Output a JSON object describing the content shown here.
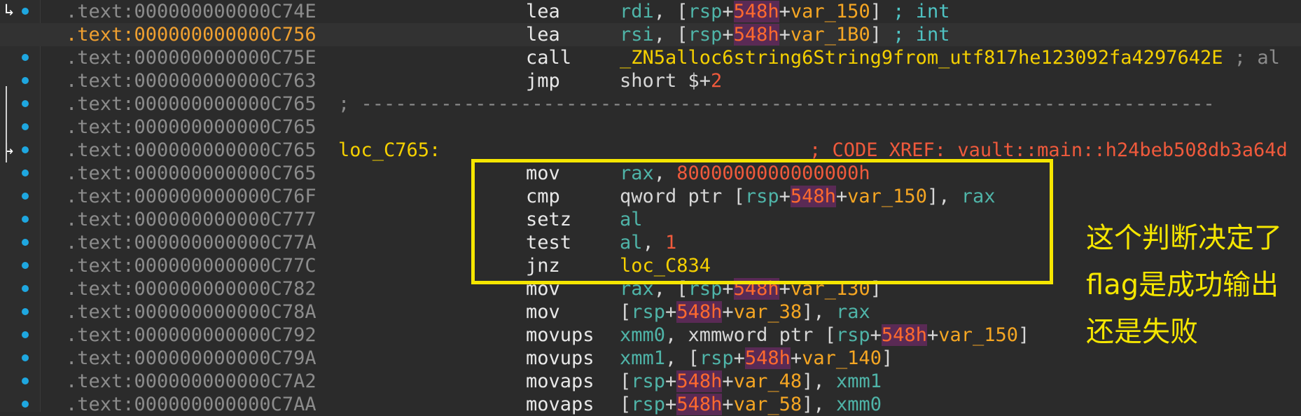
{
  "rows": [
    {
      "addr": ".text:000000000000C74E",
      "mnemonic": "lea",
      "ops": [
        [
          "reg",
          "rdi"
        ],
        [
          "plain",
          ", ["
        ],
        [
          "reg",
          "rsp"
        ],
        [
          "plain",
          "+"
        ],
        [
          "magbg",
          "548h"
        ],
        [
          "plain",
          "+"
        ],
        [
          "var",
          "var_150"
        ],
        [
          "plain",
          "] "
        ],
        [
          "cmt",
          "; int"
        ]
      ]
    },
    {
      "addr": ".text:000000000000C756",
      "current": true,
      "mnemonic": "lea",
      "ops": [
        [
          "reg",
          "rsi"
        ],
        [
          "plain",
          ", ["
        ],
        [
          "reg",
          "rsp"
        ],
        [
          "plain",
          "+"
        ],
        [
          "magbg",
          "548h"
        ],
        [
          "plain",
          "+"
        ],
        [
          "var",
          "var_1B0"
        ],
        [
          "plain",
          "] "
        ],
        [
          "cmt",
          "; int"
        ]
      ]
    },
    {
      "addr": ".text:000000000000C75E",
      "mnemonic": "call",
      "ops": [
        [
          "sym",
          "_ZN5alloc6string6String9from_utf817he123092fa4297642E"
        ],
        [
          "gray",
          " ; al"
        ]
      ]
    },
    {
      "addr": ".text:000000000000C763",
      "mnemonic": "jmp",
      "ops": [
        [
          "plain",
          "short $+"
        ],
        [
          "num",
          "2"
        ]
      ]
    },
    {
      "addr": ".text:000000000000C765",
      "sep": "; ---------------------------------------------------------------------------"
    },
    {
      "addr": ".text:000000000000C765"
    },
    {
      "addr": ".text:000000000000C765",
      "label": "loc_C765:",
      "xref": "; CODE XREF: vault::main::h24beb508db3a64d"
    },
    {
      "addr": ".text:000000000000C765",
      "mnemonic": "mov",
      "ops": [
        [
          "reg",
          "rax"
        ],
        [
          "plain",
          ", "
        ],
        [
          "num",
          "8000000000000000h"
        ]
      ]
    },
    {
      "addr": ".text:000000000000C76F",
      "mnemonic": "cmp",
      "ops": [
        [
          "plain",
          "qword ptr ["
        ],
        [
          "reg",
          "rsp"
        ],
        [
          "plain",
          "+"
        ],
        [
          "magbg",
          "548h"
        ],
        [
          "plain",
          "+"
        ],
        [
          "var",
          "var_150"
        ],
        [
          "plain",
          "], "
        ],
        [
          "reg",
          "rax"
        ]
      ]
    },
    {
      "addr": ".text:000000000000C777",
      "mnemonic": "setz",
      "ops": [
        [
          "reg",
          "al"
        ]
      ]
    },
    {
      "addr": ".text:000000000000C77A",
      "mnemonic": "test",
      "ops": [
        [
          "reg",
          "al"
        ],
        [
          "plain",
          ", "
        ],
        [
          "num",
          "1"
        ]
      ]
    },
    {
      "addr": ".text:000000000000C77C",
      "mnemonic": "jnz",
      "ops": [
        [
          "sym",
          "loc_C834"
        ]
      ]
    },
    {
      "addr": ".text:000000000000C782",
      "mnemonic": "mov",
      "ops": [
        [
          "reg",
          "rax"
        ],
        [
          "plain",
          ", ["
        ],
        [
          "reg",
          "rsp"
        ],
        [
          "plain",
          "+"
        ],
        [
          "magbg",
          "548h"
        ],
        [
          "plain",
          "+"
        ],
        [
          "var",
          "var_130"
        ],
        [
          "plain",
          "]"
        ]
      ]
    },
    {
      "addr": ".text:000000000000C78A",
      "mnemonic": "mov",
      "ops": [
        [
          "plain",
          "["
        ],
        [
          "reg",
          "rsp"
        ],
        [
          "plain",
          "+"
        ],
        [
          "magbg",
          "548h"
        ],
        [
          "plain",
          "+"
        ],
        [
          "var",
          "var_38"
        ],
        [
          "plain",
          "], "
        ],
        [
          "reg",
          "rax"
        ]
      ]
    },
    {
      "addr": ".text:000000000000C792",
      "mnemonic": "movups",
      "ops": [
        [
          "reg",
          "xmm0"
        ],
        [
          "plain",
          ", xmmword ptr ["
        ],
        [
          "reg",
          "rsp"
        ],
        [
          "plain",
          "+"
        ],
        [
          "magbg",
          "548h"
        ],
        [
          "plain",
          "+"
        ],
        [
          "var",
          "var_150"
        ],
        [
          "plain",
          "]"
        ]
      ]
    },
    {
      "addr": ".text:000000000000C79A",
      "mnemonic": "movups",
      "ops": [
        [
          "reg",
          "xmm1"
        ],
        [
          "plain",
          ", ["
        ],
        [
          "reg",
          "rsp"
        ],
        [
          "plain",
          "+"
        ],
        [
          "magbg",
          "548h"
        ],
        [
          "plain",
          "+"
        ],
        [
          "var",
          "var_140"
        ],
        [
          "plain",
          "]"
        ]
      ]
    },
    {
      "addr": ".text:000000000000C7A2",
      "mnemonic": "movaps",
      "ops": [
        [
          "plain",
          "["
        ],
        [
          "reg",
          "rsp"
        ],
        [
          "plain",
          "+"
        ],
        [
          "magbg",
          "548h"
        ],
        [
          "plain",
          "+"
        ],
        [
          "var",
          "var_48"
        ],
        [
          "plain",
          "], "
        ],
        [
          "reg",
          "xmm1"
        ]
      ]
    },
    {
      "addr": ".text:000000000000C7AA",
      "mnemonic": "movaps",
      "ops": [
        [
          "plain",
          "["
        ],
        [
          "reg",
          "rsp"
        ],
        [
          "plain",
          "+"
        ],
        [
          "magbg",
          "548h"
        ],
        [
          "plain",
          "+"
        ],
        [
          "var",
          "var_58"
        ],
        [
          "plain",
          "], "
        ],
        [
          "reg",
          "xmm0"
        ]
      ]
    }
  ],
  "annotation": [
    "这个判断决定了",
    "flag是成功输出",
    "还是失败"
  ]
}
